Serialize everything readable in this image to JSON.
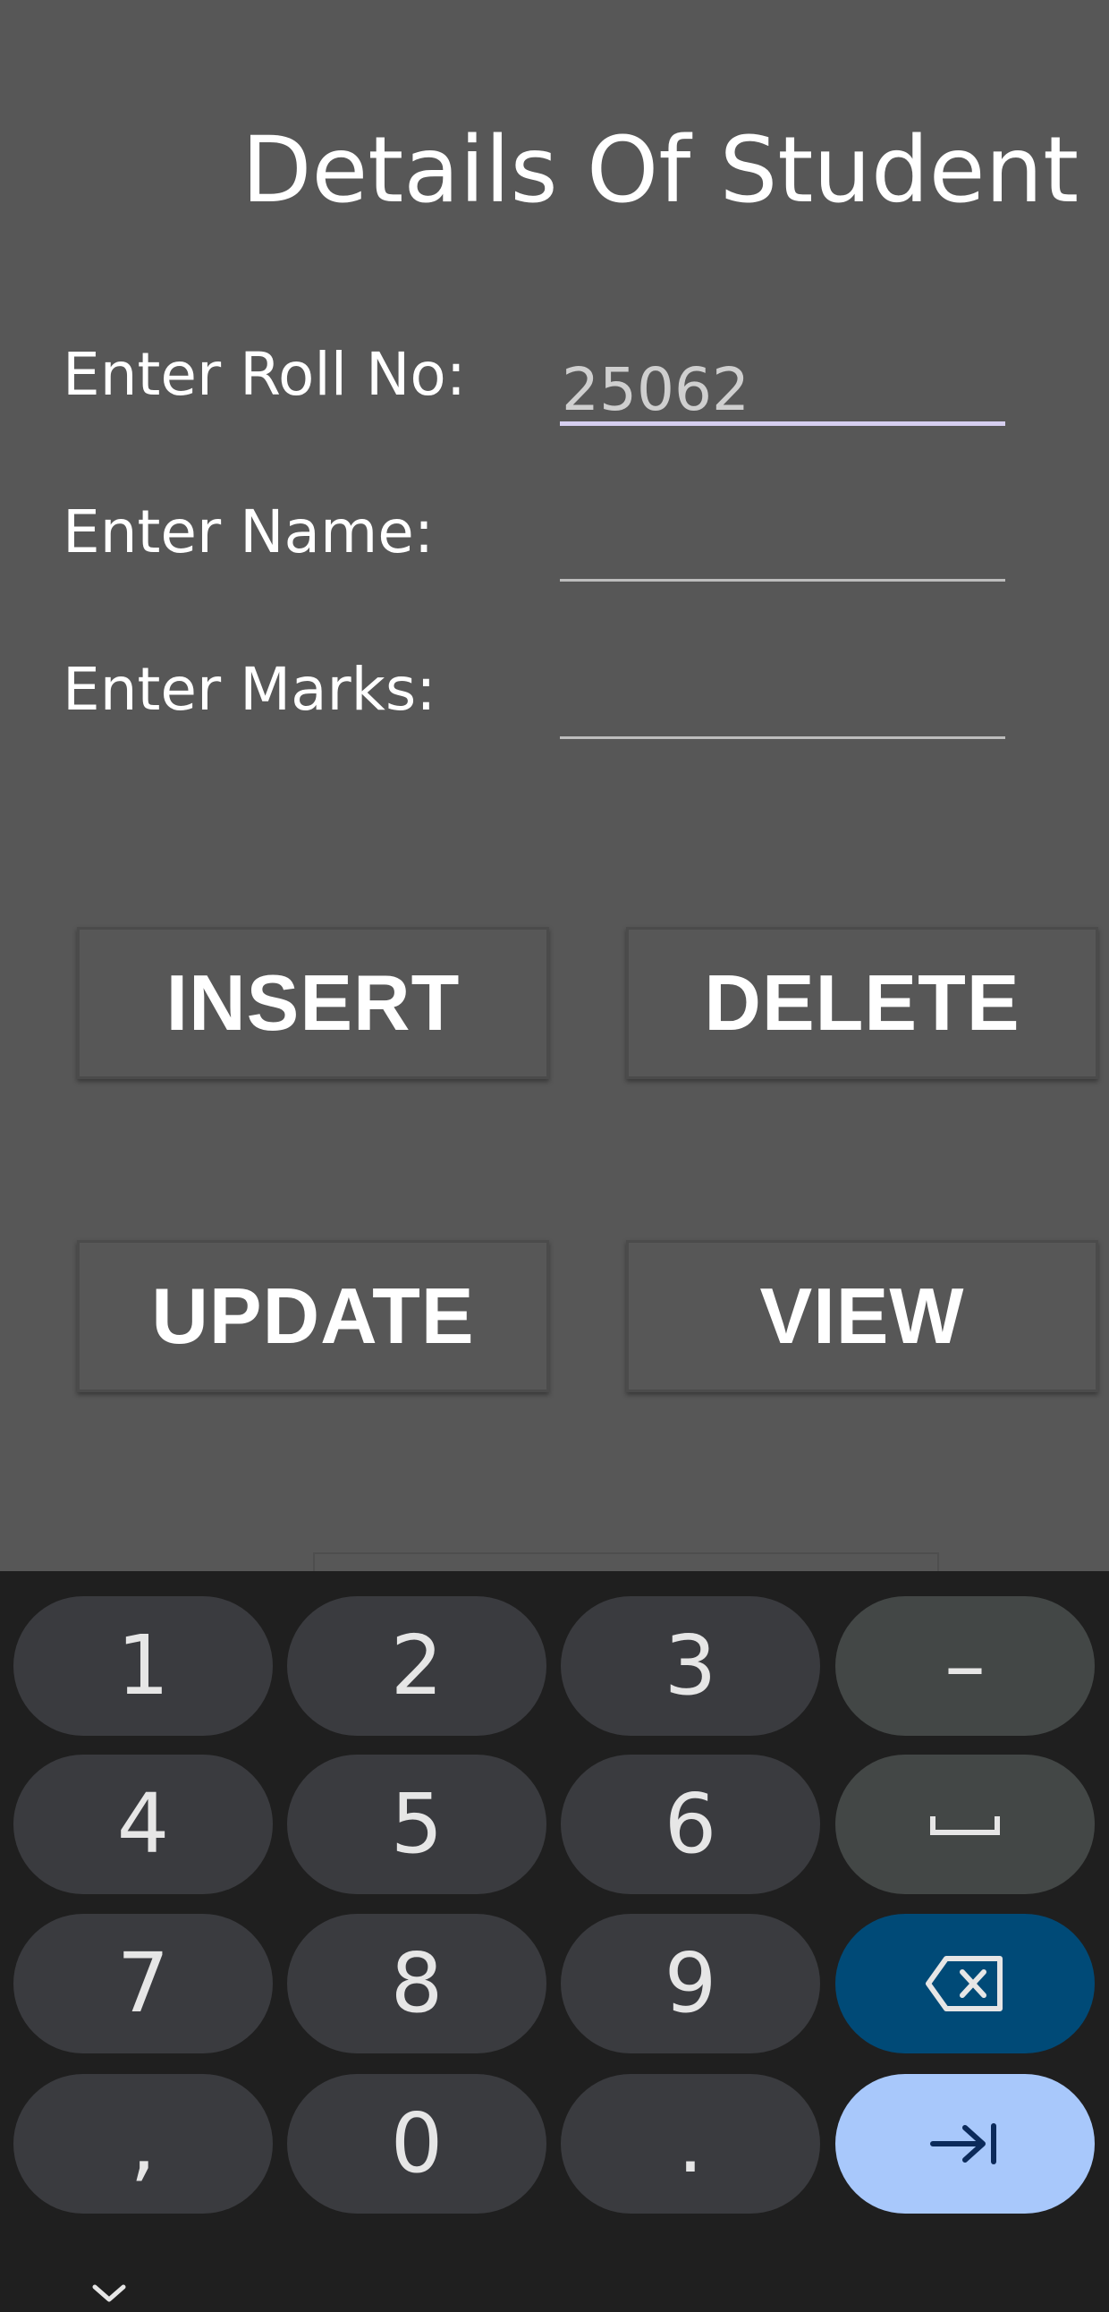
{
  "header": {
    "title": "Details Of Student"
  },
  "form": {
    "roll_label": "Enter Roll No:",
    "roll_value": "25062",
    "name_label": "Enter Name:",
    "name_value": "",
    "marks_label": "Enter Marks:",
    "marks_value": ""
  },
  "buttons": {
    "insert": "INSERT",
    "delete": "DELETE",
    "update": "UPDATE",
    "view": "VIEW"
  },
  "keyboard": {
    "keys": [
      "1",
      "2",
      "3",
      "–",
      "4",
      "5",
      "6",
      "7",
      "8",
      "9",
      ",",
      "0",
      "."
    ],
    "icons": {
      "space": "space-bar-icon",
      "backspace": "backspace-icon",
      "next": "tab-next-icon",
      "collapse": "chevron-down-icon"
    }
  },
  "colors": {
    "background": "#575757",
    "keyboard_background": "#1f1f1f",
    "key": "#3a3b3f",
    "function_key": "#434746",
    "backspace_key": "#004a77",
    "action_key": "#a8c8fb",
    "input_focus_underline": "#d6cff0"
  }
}
